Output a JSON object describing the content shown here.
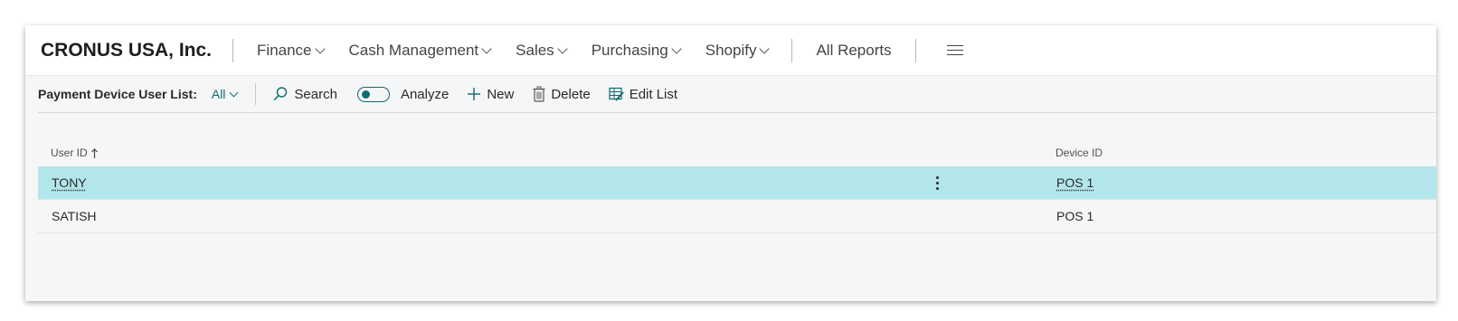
{
  "navbar": {
    "company": "CRONUS USA, Inc.",
    "menu": [
      {
        "label": "Finance"
      },
      {
        "label": "Cash Management"
      },
      {
        "label": "Sales"
      },
      {
        "label": "Purchasing"
      },
      {
        "label": "Shopify"
      }
    ],
    "all_reports": "All Reports",
    "more_icon": "hamburger-icon"
  },
  "actionbar": {
    "page_name": "Payment Device User List:",
    "filter_value": "All",
    "search_label": "Search",
    "analyze_label": "Analyze",
    "new_label": "New",
    "delete_label": "Delete",
    "edit_list_label": "Edit List"
  },
  "table": {
    "columns": [
      {
        "label": "User ID",
        "sorted": "ascending"
      },
      {
        "label": "Device ID"
      }
    ],
    "rows": [
      {
        "user_id": "TONY",
        "device_id": "POS 1",
        "selected": true
      },
      {
        "user_id": "SATISH",
        "device_id": "POS 1",
        "selected": false
      }
    ]
  },
  "colors": {
    "accent": "#0f6b72",
    "selected_row": "#b2e6ea",
    "page_background": "#f5f6f7"
  }
}
